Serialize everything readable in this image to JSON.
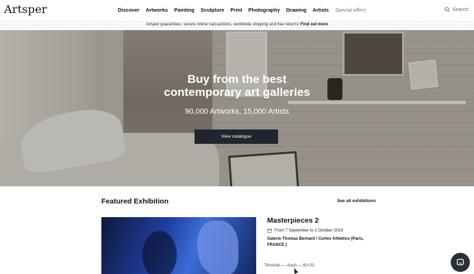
{
  "brand": {
    "logo": "Artsper"
  },
  "nav": {
    "items": [
      "Discover",
      "Artworks",
      "Painting",
      "Sculpture",
      "Print",
      "Photography",
      "Drawing",
      "Artists"
    ],
    "special": "Special offers",
    "search_label": "Search"
  },
  "guarantee": {
    "text": "Artsper guarantees: secure online transactions, worldwide shipping and free returns! ",
    "link": "Find out more"
  },
  "hero": {
    "title_line1": "Buy from the best",
    "title_line2": "contemporary art galleries",
    "subtitle": "90,000 Artworks, 15,000 Artists",
    "button": "View catalogue"
  },
  "featured": {
    "heading": "Featured Exhibition",
    "see_all": "See all exhibitions",
    "exhibition": {
      "name": "Masterpieces 2",
      "dates": "From 7 September to 2 October 2019",
      "gallery": "Galerie Thomas Bernard / Cortex Athletico (Paris, FRANCE )"
    }
  },
  "overlay": {
    "tooltip": "Terminal — -bash — 82×32"
  },
  "icons": {
    "search": "search-icon",
    "calendar": "calendar-icon",
    "chat": "chat-icon"
  },
  "colors": {
    "button_bg": "#21252e",
    "chat_bg": "#2b2f38"
  }
}
